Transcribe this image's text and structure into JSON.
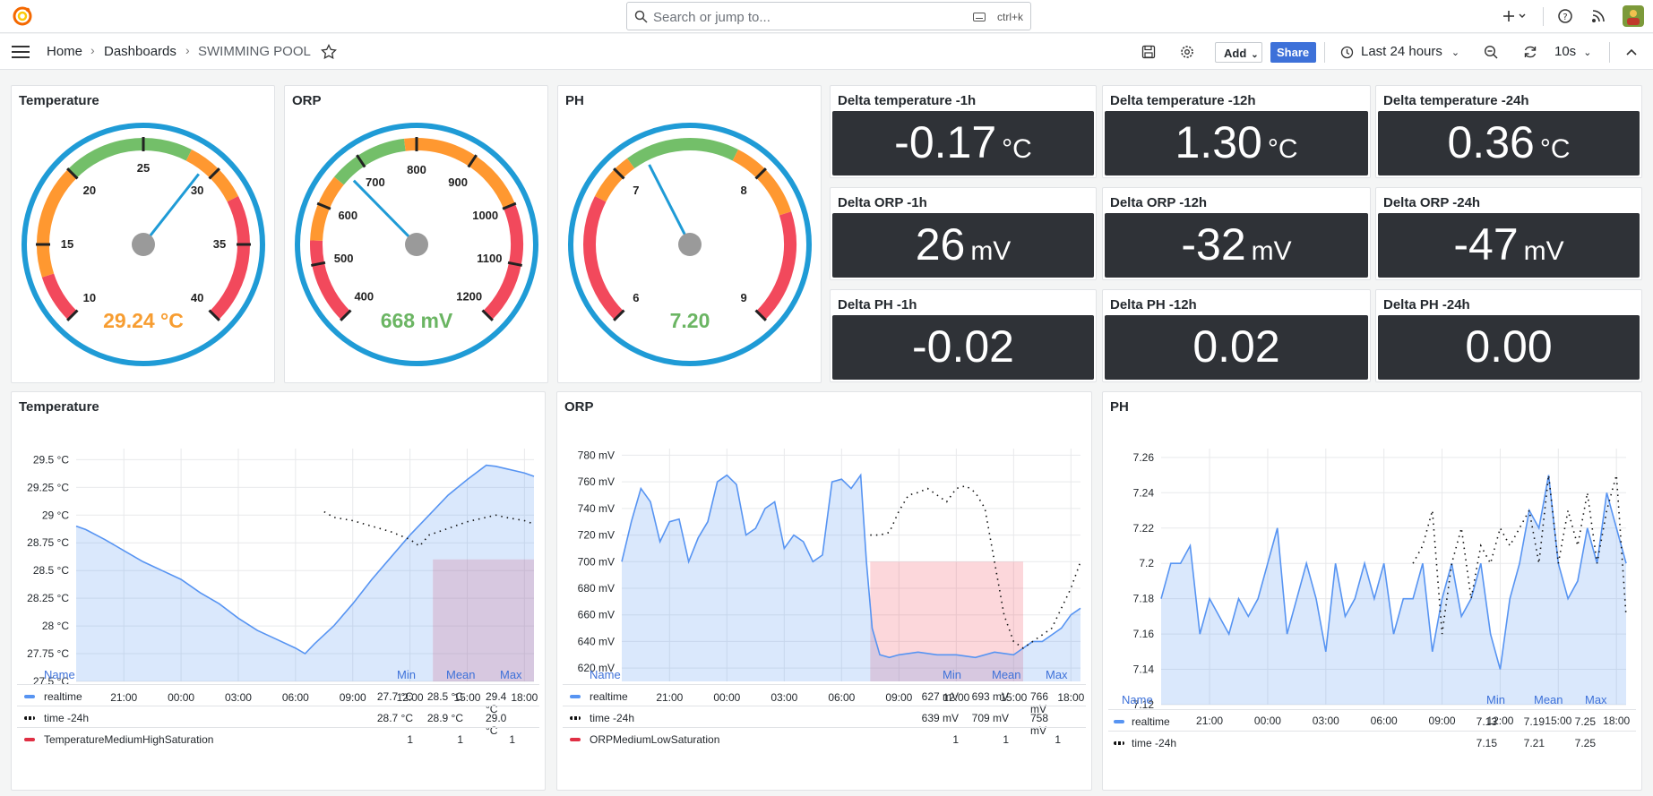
{
  "search": {
    "placeholder": "Search or jump to...",
    "shortcut": "ctrl+k"
  },
  "breadcrumb": {
    "home": "Home",
    "dashboards": "Dashboards",
    "current": "SWIMMING POOL"
  },
  "toolbar": {
    "add_label": "Add",
    "share_label": "Share",
    "time_range": "Last 24 hours",
    "refresh_interval": "10s"
  },
  "gauges": [
    {
      "title": "Temperature",
      "value_text": "29.24 °C",
      "value": 29.24,
      "min": 10,
      "max": 40,
      "ticks": [
        "10",
        "15",
        "20",
        "25",
        "30",
        "35",
        "40"
      ],
      "value_color": "#f79d31"
    },
    {
      "title": "ORP",
      "value_text": "668 mV",
      "value": 668,
      "min": 400,
      "max": 1200,
      "ticks": [
        "400",
        "500",
        "600",
        "700",
        "800",
        "900",
        "1000",
        "1100",
        "1200"
      ],
      "value_color": "#6bb563"
    },
    {
      "title": "PH",
      "value_text": "7.20",
      "value": 7.2,
      "min": 6,
      "max": 9,
      "ticks": [
        "6",
        "7",
        "8",
        "9"
      ],
      "value_color": "#6bb563"
    }
  ],
  "stats": [
    {
      "title": "Delta temperature -1h",
      "value": "-0.17",
      "unit": "°C"
    },
    {
      "title": "Delta temperature -12h",
      "value": "1.30",
      "unit": "°C"
    },
    {
      "title": "Delta temperature -24h",
      "value": "0.36",
      "unit": "°C"
    },
    {
      "title": "Delta ORP -1h",
      "value": "26",
      "unit": "mV"
    },
    {
      "title": "Delta ORP -12h",
      "value": "-32",
      "unit": "mV"
    },
    {
      "title": "Delta ORP -24h",
      "value": "-47",
      "unit": "mV"
    },
    {
      "title": "Delta PH -1h",
      "value": "-0.02",
      "unit": ""
    },
    {
      "title": "Delta PH -12h",
      "value": "0.02",
      "unit": ""
    },
    {
      "title": "Delta PH -24h",
      "value": "0.00",
      "unit": ""
    }
  ],
  "colors": {
    "accent": "#3d71d9",
    "series_blue": "#5794f2",
    "threshold_red": "#e02f44",
    "gauge_ring": "#1f9bd6",
    "green": "#73bf69",
    "orange": "#ff9830",
    "red": "#f2495c"
  },
  "legend_headers": {
    "name": "Name",
    "min": "Min",
    "mean": "Mean",
    "max": "Max"
  },
  "chart_data": [
    {
      "type": "line",
      "title": "Temperature",
      "x_ticks": [
        "21:00",
        "00:00",
        "03:00",
        "06:00",
        "09:00",
        "12:00",
        "15:00",
        "18:00"
      ],
      "y_ticks": [
        "27.5 °C",
        "27.75 °C",
        "28 °C",
        "28.25 °C",
        "28.5 °C",
        "28.75 °C",
        "29 °C",
        "29.25 °C",
        "29.5 °C"
      ],
      "ylim": [
        27.5,
        29.6
      ],
      "x_hours": [
        -2.5,
        21.5
      ],
      "series": [
        {
          "name": "realtime",
          "style": "area",
          "x": [
            -2.5,
            -2,
            -1,
            0,
            1,
            2,
            3,
            4,
            5,
            6,
            7,
            8,
            9,
            9.5,
            10,
            11,
            12,
            13,
            14,
            15,
            16,
            17,
            18,
            19,
            19.5,
            20,
            20.5,
            21,
            21.5
          ],
          "y": [
            28.9,
            28.87,
            28.78,
            28.68,
            28.58,
            28.5,
            28.42,
            28.3,
            28.2,
            28.07,
            27.96,
            27.88,
            27.8,
            27.75,
            27.84,
            28.0,
            28.2,
            28.42,
            28.62,
            28.82,
            29.0,
            29.18,
            29.32,
            29.45,
            29.44,
            29.42,
            29.4,
            29.38,
            29.35
          ]
        },
        {
          "name": "time -24h",
          "style": "dotted",
          "x": [
            10.5,
            11,
            12,
            13,
            14,
            15,
            15.5,
            16,
            17,
            18,
            19,
            19.5,
            20,
            21,
            21.5
          ],
          "y": [
            29.03,
            28.98,
            28.95,
            28.9,
            28.85,
            28.78,
            28.72,
            28.82,
            28.88,
            28.94,
            28.98,
            29.0,
            28.98,
            28.95,
            28.92
          ]
        },
        {
          "name": "TemperatureMediumHighSaturation",
          "style": "band",
          "x": [
            16.2,
            21.5
          ],
          "y": [
            27.5,
            28.6
          ]
        }
      ],
      "legend": [
        {
          "name": "realtime",
          "min": "27.7 °C",
          "mean": "28.5 °C",
          "max": "29.4 °C"
        },
        {
          "name": "time -24h",
          "min": "28.7 °C",
          "mean": "28.9 °C",
          "max": "29.0 °C"
        },
        {
          "name": "TemperatureMediumHighSaturation",
          "min": "1",
          "mean": "1",
          "max": "1"
        }
      ]
    },
    {
      "type": "line",
      "title": "ORP",
      "x_ticks": [
        "21:00",
        "00:00",
        "03:00",
        "06:00",
        "09:00",
        "12:00",
        "15:00",
        "18:00"
      ],
      "y_ticks": [
        "620 mV",
        "640 mV",
        "660 mV",
        "680 mV",
        "700 mV",
        "720 mV",
        "740 mV",
        "760 mV",
        "780 mV"
      ],
      "ylim": [
        610,
        785
      ],
      "x_hours": [
        -2.5,
        21.5
      ],
      "series": [
        {
          "name": "realtime",
          "style": "area",
          "x": [
            -2.5,
            -2,
            -1.5,
            -1,
            -0.5,
            0,
            0.5,
            1,
            1.5,
            2,
            2.5,
            3,
            3.5,
            4,
            4.5,
            5,
            5.5,
            6,
            6.5,
            7,
            7.5,
            8,
            8.5,
            9,
            9.5,
            10,
            10.3,
            10.6,
            11,
            11.5,
            12,
            13,
            14,
            15,
            16,
            17,
            18,
            18.5,
            19,
            19.5,
            20,
            20.5,
            21,
            21.5
          ],
          "y": [
            700,
            730,
            755,
            745,
            715,
            730,
            732,
            700,
            718,
            730,
            760,
            765,
            758,
            720,
            725,
            740,
            745,
            710,
            720,
            715,
            700,
            705,
            760,
            762,
            755,
            765,
            700,
            650,
            630,
            628,
            630,
            632,
            630,
            630,
            628,
            632,
            630,
            635,
            640,
            640,
            645,
            650,
            660,
            665
          ]
        },
        {
          "name": "time -24h",
          "style": "dotted",
          "x": [
            10.5,
            11,
            11.5,
            12,
            12.5,
            13,
            13.5,
            14,
            14.5,
            15,
            15.5,
            16,
            16.5,
            17,
            17.5,
            18,
            18.5,
            19,
            19.5,
            20,
            20.5,
            21,
            21.5
          ],
          "y": [
            720,
            720,
            722,
            738,
            750,
            752,
            755,
            750,
            745,
            755,
            757,
            752,
            740,
            700,
            660,
            640,
            635,
            640,
            645,
            650,
            665,
            680,
            700
          ]
        },
        {
          "name": "ORPMediumLowSaturation",
          "style": "band",
          "x": [
            10.5,
            18.5
          ],
          "y": [
            610,
            700
          ]
        }
      ],
      "legend": [
        {
          "name": "realtime",
          "min": "627 mV",
          "mean": "693 mV",
          "max": "766 mV"
        },
        {
          "name": "time -24h",
          "min": "639 mV",
          "mean": "709 mV",
          "max": "758 mV"
        },
        {
          "name": "ORPMediumLowSaturation",
          "min": "1",
          "mean": "1",
          "max": "1"
        }
      ]
    },
    {
      "type": "line",
      "title": "PH",
      "x_ticks": [
        "21:00",
        "00:00",
        "03:00",
        "06:00",
        "09:00",
        "12:00",
        "15:00",
        "18:00"
      ],
      "y_ticks": [
        "7.12",
        "7.14",
        "7.16",
        "7.18",
        "7.2",
        "7.22",
        "7.24",
        "7.26"
      ],
      "ylim": [
        7.12,
        7.265
      ],
      "x_hours": [
        -2.5,
        21.5
      ],
      "series": [
        {
          "name": "realtime",
          "style": "area",
          "x": [
            -2.5,
            -2,
            -1.5,
            -1,
            -0.5,
            0,
            0.5,
            1,
            1.5,
            2,
            2.5,
            3,
            3.5,
            4,
            4.5,
            5,
            5.5,
            6,
            6.5,
            7,
            7.5,
            8,
            8.5,
            9,
            9.5,
            10,
            10.5,
            11,
            11.5,
            12,
            12.5,
            13,
            13.5,
            14,
            14.5,
            15,
            15.5,
            16,
            16.5,
            17,
            17.5,
            18,
            18.5,
            19,
            19.5,
            20,
            20.5,
            21,
            21.5
          ],
          "y": [
            7.18,
            7.2,
            7.2,
            7.21,
            7.16,
            7.18,
            7.17,
            7.16,
            7.18,
            7.17,
            7.18,
            7.2,
            7.22,
            7.16,
            7.18,
            7.2,
            7.18,
            7.15,
            7.2,
            7.17,
            7.18,
            7.2,
            7.18,
            7.2,
            7.16,
            7.18,
            7.18,
            7.2,
            7.15,
            7.18,
            7.2,
            7.17,
            7.18,
            7.2,
            7.16,
            7.14,
            7.18,
            7.2,
            7.23,
            7.22,
            7.25,
            7.2,
            7.18,
            7.19,
            7.22,
            7.2,
            7.24,
            7.22,
            7.2
          ]
        },
        {
          "name": "time -24h",
          "style": "dotted",
          "x": [
            10.5,
            11,
            11.5,
            12,
            12.5,
            13,
            13.5,
            14,
            14.5,
            15,
            15.5,
            16,
            16.5,
            17,
            17.5,
            18,
            18.5,
            19,
            19.5,
            20,
            20.5,
            21,
            21.5
          ],
          "y": [
            7.2,
            7.21,
            7.23,
            7.16,
            7.2,
            7.22,
            7.18,
            7.21,
            7.2,
            7.22,
            7.21,
            7.22,
            7.23,
            7.2,
            7.25,
            7.2,
            7.23,
            7.21,
            7.24,
            7.2,
            7.23,
            7.25,
            7.17
          ]
        }
      ],
      "legend": [
        {
          "name": "realtime",
          "min": "7.13",
          "mean": "7.19",
          "max": "7.25"
        },
        {
          "name": "time -24h",
          "min": "7.15",
          "mean": "7.21",
          "max": "7.25"
        }
      ]
    }
  ]
}
